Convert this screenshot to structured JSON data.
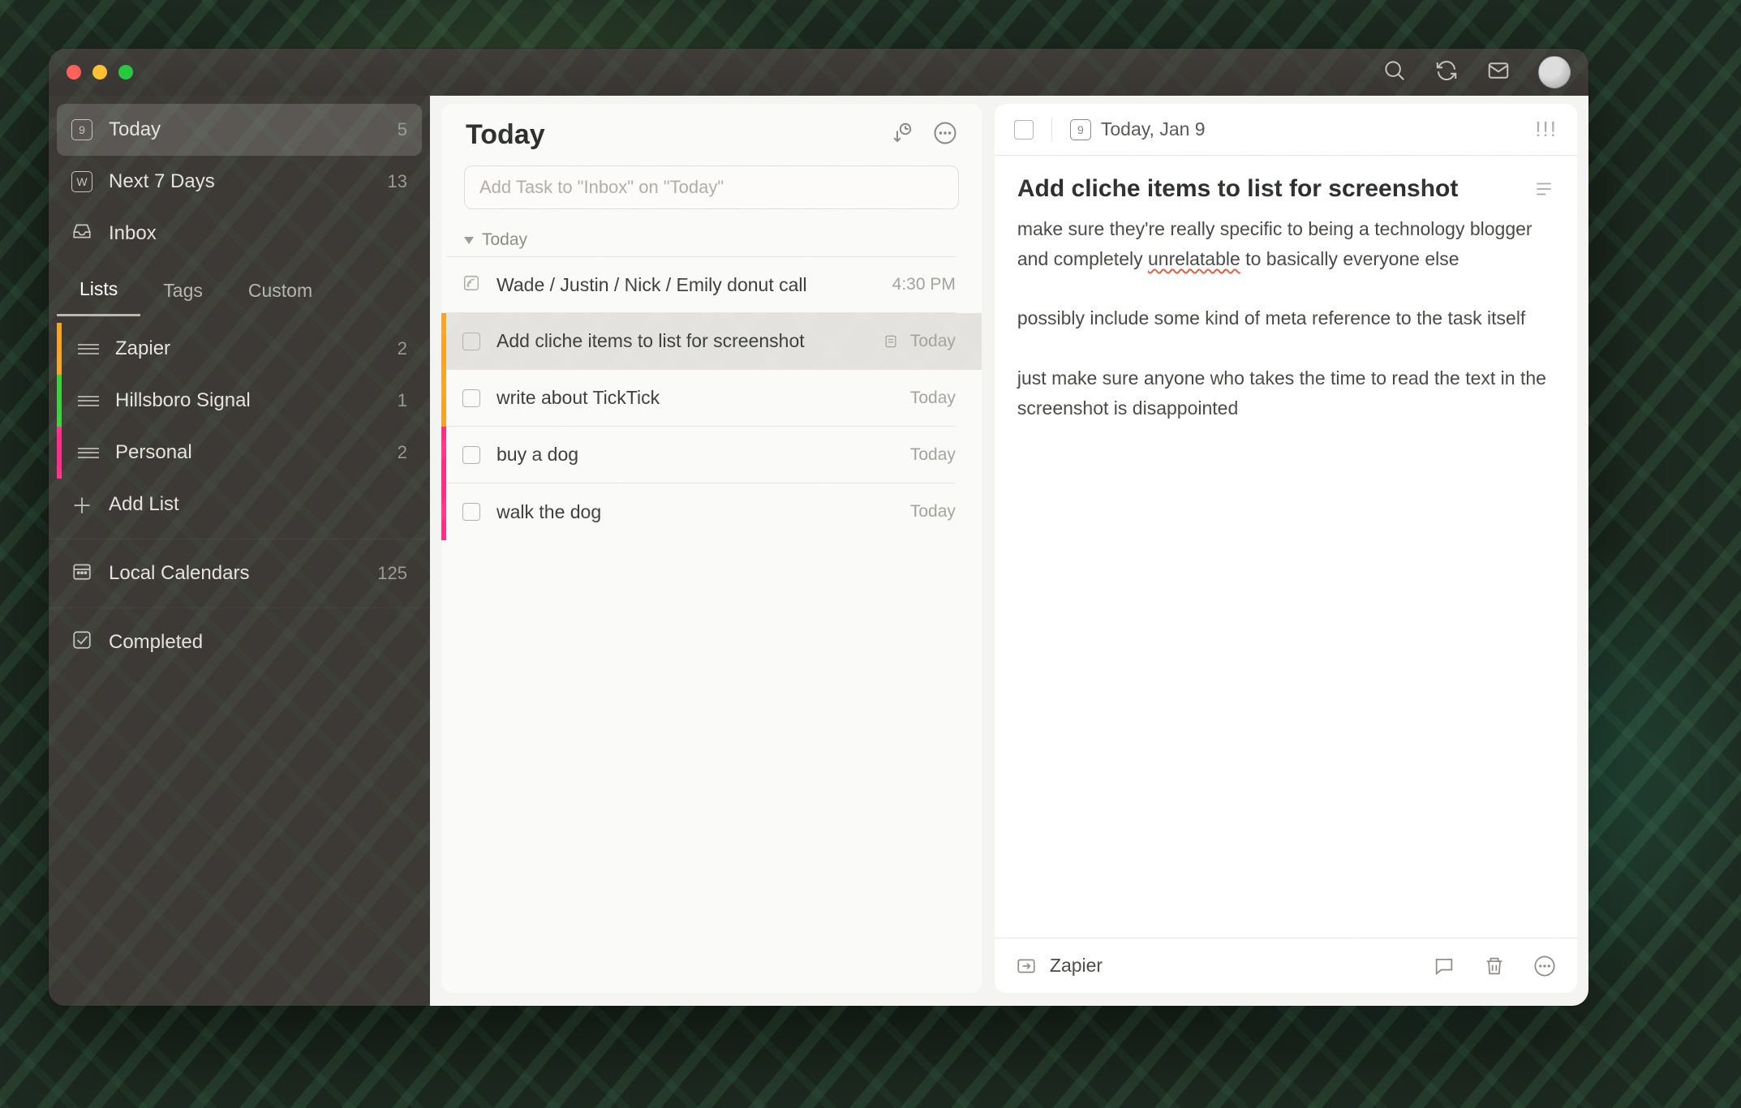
{
  "titlebar": {
    "avatar_alt": "User avatar"
  },
  "sidebar": {
    "smart": [
      {
        "label": "Today",
        "count": "5",
        "badge": "9",
        "active": true
      },
      {
        "label": "Next 7 Days",
        "count": "13",
        "badge": "W",
        "active": false
      },
      {
        "label": "Inbox",
        "count": "",
        "badge": "",
        "active": false
      }
    ],
    "tabs": {
      "lists": "Lists",
      "tags": "Tags",
      "custom": "Custom",
      "active": "lists"
    },
    "lists": [
      {
        "label": "Zapier",
        "count": "2",
        "color": "c-orange"
      },
      {
        "label": "Hillsboro Signal",
        "count": "1",
        "color": "c-green"
      },
      {
        "label": "Personal",
        "count": "2",
        "color": "c-pink"
      }
    ],
    "add_label": "Add List",
    "calendars": {
      "label": "Local Calendars",
      "count": "125"
    },
    "completed": {
      "label": "Completed"
    }
  },
  "list": {
    "title": "Today",
    "add_placeholder": "Add Task to \"Inbox\" on \"Today\"",
    "group_label": "Today",
    "tasks": [
      {
        "title": "Wade / Justin / Nick / Emily donut call",
        "meta": "4:30 PM",
        "color": "c-none",
        "selected": false,
        "feed": true,
        "note_icon": false
      },
      {
        "title": "Add cliche items to list for screenshot",
        "meta": "Today",
        "color": "c-orange",
        "selected": true,
        "feed": false,
        "note_icon": true
      },
      {
        "title": "write about TickTick",
        "meta": "Today",
        "color": "c-orange",
        "selected": false,
        "feed": false,
        "note_icon": false
      },
      {
        "title": "buy a dog",
        "meta": "Today",
        "color": "c-pink",
        "selected": false,
        "feed": false,
        "note_icon": false
      },
      {
        "title": "walk the dog",
        "meta": "Today",
        "color": "c-pink",
        "selected": false,
        "feed": false,
        "note_icon": false
      }
    ]
  },
  "detail": {
    "date": "Today, Jan 9",
    "cal_badge": "9",
    "title": "Add cliche items to list for screenshot",
    "note_pre": "make sure they're really specific to being a technology blogger and completely ",
    "note_squiggle": "unrelatable",
    "note_post": " to basically everyone else\n\npossibly include some kind of meta reference to the task itself\n\njust make sure anyone who takes the time to read the text in the screenshot is disappointed",
    "project": "Zapier",
    "priority_glyph": "!!!"
  }
}
